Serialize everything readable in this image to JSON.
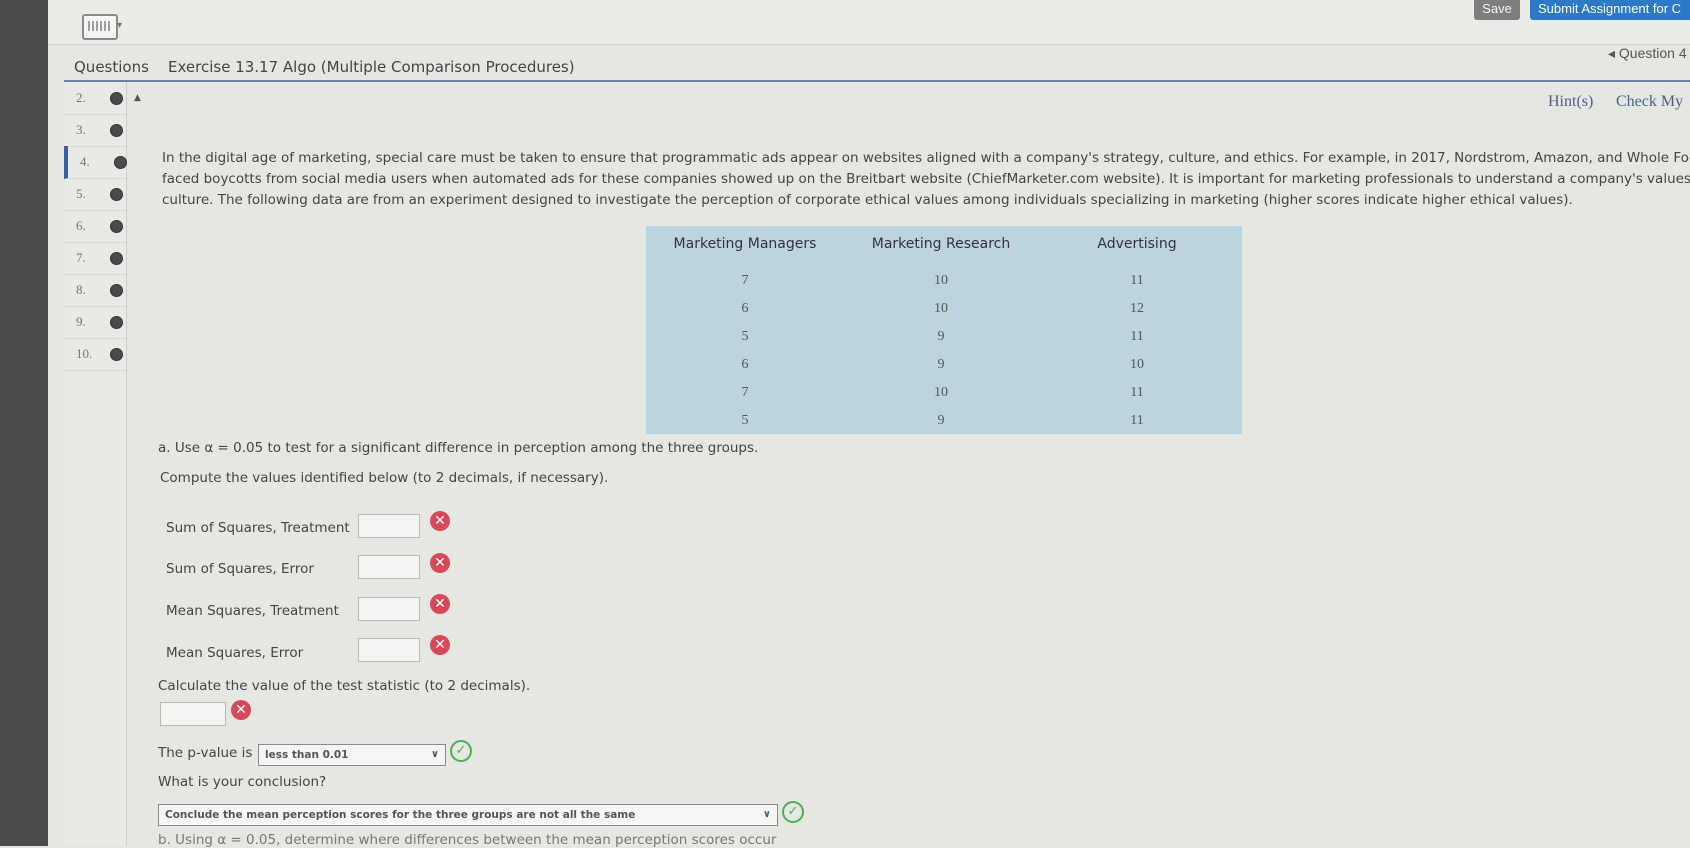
{
  "toolbar": {
    "save_label": "Save",
    "submit_label": "Submit Assignment for C"
  },
  "header": {
    "questions_tab": "Questions",
    "title": "Exercise 13.17 Algo (Multiple Comparison Procedures)",
    "question_nav": "◂ Question 4"
  },
  "links": {
    "hints": "Hint(s)",
    "check": "Check My"
  },
  "sidebar": {
    "items": [
      {
        "num": "2."
      },
      {
        "num": "3."
      },
      {
        "num": "4.",
        "current": true
      },
      {
        "num": "5."
      },
      {
        "num": "6."
      },
      {
        "num": "7."
      },
      {
        "num": "8."
      },
      {
        "num": "9."
      },
      {
        "num": "10."
      }
    ]
  },
  "intro": {
    "line1": "In the digital age of marketing, special care must be taken to ensure that programmatic ads appear on websites aligned with a company's strategy, culture, and ethics. For example, in 2017, Nordstrom, Amazon, and Whole Foo",
    "line2": "faced boycotts from social media users when automated ads for these companies showed up on the Breitbart website (ChiefMarketer.com website). It is important for marketing professionals to understand a company's values a",
    "line3": "culture. The following data are from an experiment designed to investigate the perception of corporate ethical values among individuals specializing in marketing (higher scores indicate higher ethical values)."
  },
  "table": {
    "headers": [
      "Marketing Managers",
      "Marketing Research",
      "Advertising"
    ],
    "rows": [
      [
        "7",
        "10",
        "11"
      ],
      [
        "6",
        "10",
        "12"
      ],
      [
        "5",
        "9",
        "11"
      ],
      [
        "6",
        "9",
        "10"
      ],
      [
        "7",
        "10",
        "11"
      ],
      [
        "5",
        "9",
        "11"
      ]
    ]
  },
  "part_a": {
    "prompt": "a. Use α = 0.05 to test for a significant difference in perception among the three groups.",
    "instructions": "Compute the values identified below (to 2 decimals, if necessary).",
    "fields": [
      {
        "label": "Sum of Squares, Treatment",
        "value": ""
      },
      {
        "label": "Sum of Squares, Error",
        "value": ""
      },
      {
        "label": "Mean Squares, Treatment",
        "value": ""
      },
      {
        "label": "Mean Squares, Error",
        "value": ""
      }
    ],
    "test_stat_label": "Calculate the value of the test statistic (to 2 decimals).",
    "test_stat_value": "",
    "pvalue_label": "The p-value is",
    "pvalue_selected": "less than 0.01",
    "conclusion_q": "What is your conclusion?",
    "conclusion_selected": "Conclude the mean perception scores for the three groups are not all the same"
  },
  "part_b": {
    "prompt": "b. Using α = 0.05, determine where differences between the mean perception scores occur"
  },
  "colors": {
    "accent": "#2e78c8",
    "error": "#d8485b",
    "ok": "#4caf50",
    "table_bg": "#bcd3e0"
  }
}
